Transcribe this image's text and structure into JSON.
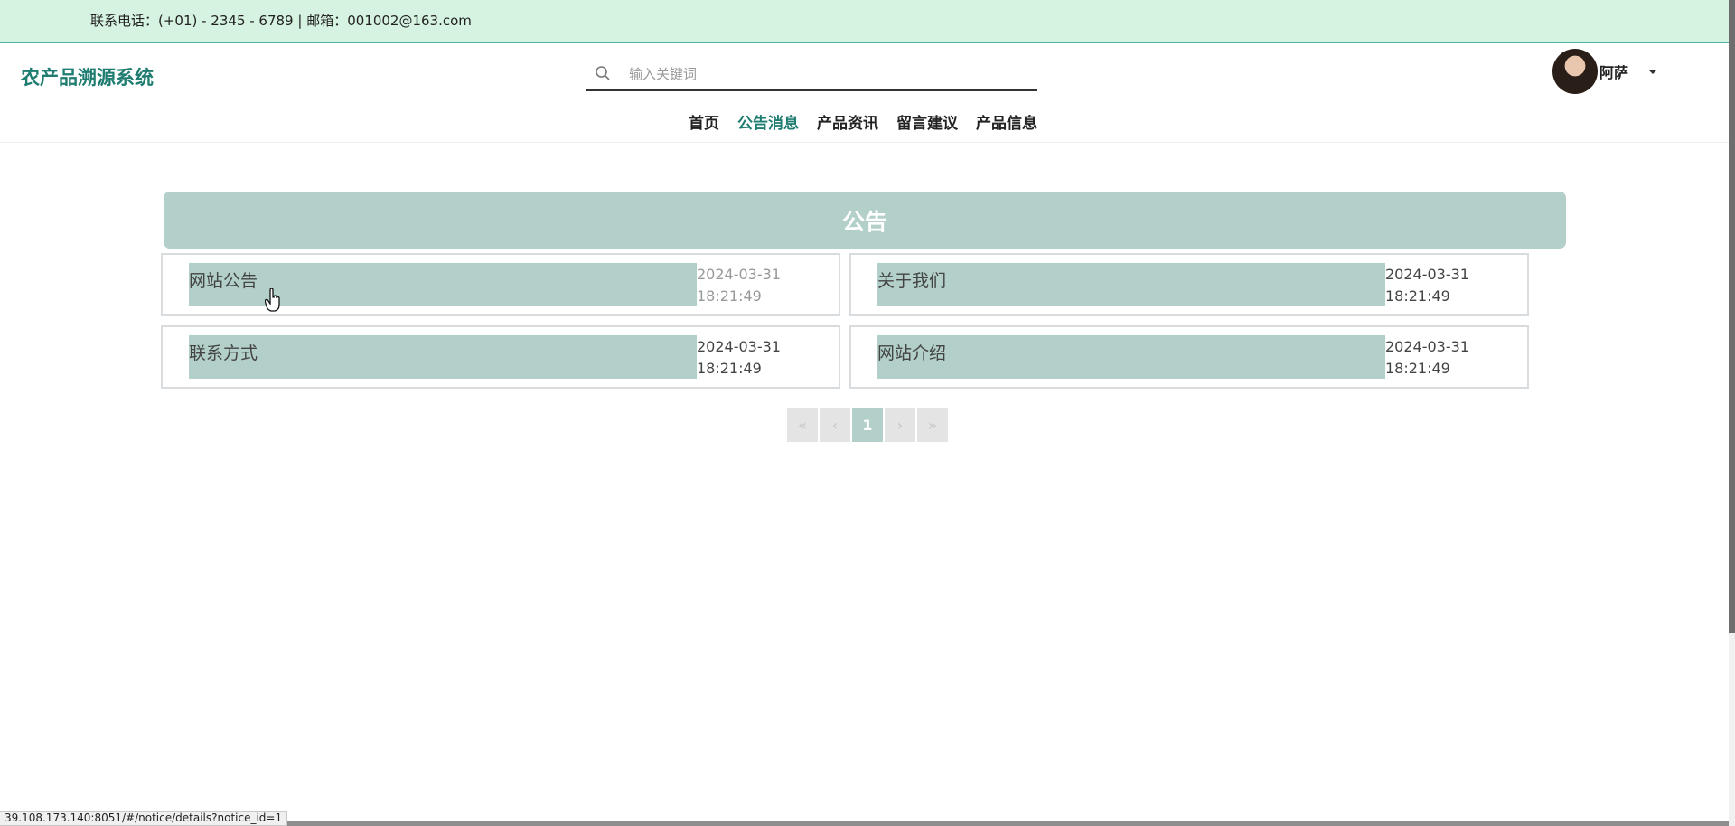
{
  "topbar": {
    "contact": "联系电话：(+01) - 2345 - 6789 | 邮箱：001002@163.com"
  },
  "header": {
    "logo": "农产品溯源系统",
    "search_placeholder": "输入关键词",
    "user_name": "阿萨"
  },
  "nav": {
    "items": [
      {
        "label": "首页",
        "active": false
      },
      {
        "label": "公告消息",
        "active": true
      },
      {
        "label": "产品资讯",
        "active": false
      },
      {
        "label": "留言建议",
        "active": false
      },
      {
        "label": "产品信息",
        "active": false
      }
    ]
  },
  "main": {
    "banner_title": "公告",
    "notices": [
      {
        "title": "网站公告",
        "date": "2024-03-31",
        "time": "18:21:49"
      },
      {
        "title": "关于我们",
        "date": "2024-03-31",
        "time": "18:21:49"
      },
      {
        "title": "联系方式",
        "date": "2024-03-31",
        "time": "18:21:49"
      },
      {
        "title": "网站介绍",
        "date": "2024-03-31",
        "time": "18:21:49"
      }
    ],
    "pagination": {
      "first": "«",
      "prev": "‹",
      "current": "1",
      "next": "›",
      "last": "»"
    }
  },
  "statusbar": {
    "url": "39.108.173.140:8051/#/notice/details?notice_id=1"
  },
  "colors": {
    "accent": "#1e7c70",
    "banner": "#b2cfc9",
    "topbar_bg": "#d6f3e2"
  }
}
